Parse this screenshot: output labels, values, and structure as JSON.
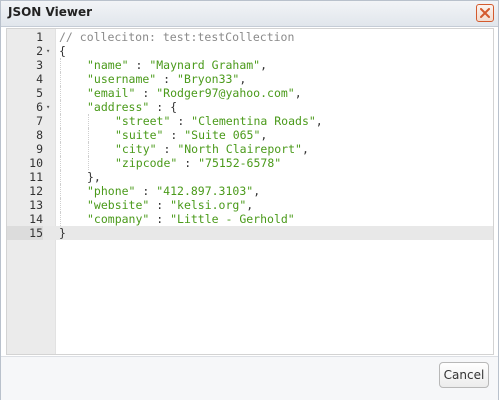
{
  "window": {
    "title": "JSON Viewer",
    "close_icon": "close-icon"
  },
  "colors": {
    "string": "#4a9a1a",
    "comment": "#8a8a8a",
    "close_border": "#d35a2e"
  },
  "editor": {
    "active_line": 15,
    "lines": [
      {
        "n": "1",
        "fold": "",
        "indent": 0,
        "comment": "// colleciton: test:testCollection"
      },
      {
        "n": "2",
        "fold": "▾",
        "indent": 0,
        "punc": "{"
      },
      {
        "n": "3",
        "fold": "",
        "indent": 1,
        "key": "\"name\"",
        "sep": " : ",
        "value": "\"Maynard Graham\"",
        "trail": ","
      },
      {
        "n": "4",
        "fold": "",
        "indent": 1,
        "key": "\"username\"",
        "sep": " : ",
        "value": "\"Bryon33\"",
        "trail": ","
      },
      {
        "n": "5",
        "fold": "",
        "indent": 1,
        "key": "\"email\"",
        "sep": " : ",
        "value": "\"Rodger97@yahoo.com\"",
        "trail": ","
      },
      {
        "n": "6",
        "fold": "▾",
        "indent": 1,
        "key": "\"address\"",
        "sep": " : ",
        "value": "",
        "trail": "{"
      },
      {
        "n": "7",
        "fold": "",
        "indent": 2,
        "key": "\"street\"",
        "sep": " : ",
        "value": "\"Clementina Roads\"",
        "trail": ","
      },
      {
        "n": "8",
        "fold": "",
        "indent": 2,
        "key": "\"suite\"",
        "sep": " : ",
        "value": "\"Suite 065\"",
        "trail": ","
      },
      {
        "n": "9",
        "fold": "",
        "indent": 2,
        "key": "\"city\"",
        "sep": " : ",
        "value": "\"North Claireport\"",
        "trail": ","
      },
      {
        "n": "10",
        "fold": "",
        "indent": 2,
        "key": "\"zipcode\"",
        "sep": " : ",
        "value": "\"75152-6578\"",
        "trail": ""
      },
      {
        "n": "11",
        "fold": "",
        "indent": 1,
        "punc": "},"
      },
      {
        "n": "12",
        "fold": "",
        "indent": 1,
        "key": "\"phone\"",
        "sep": " : ",
        "value": "\"412.897.3103\"",
        "trail": ","
      },
      {
        "n": "13",
        "fold": "",
        "indent": 1,
        "key": "\"website\"",
        "sep": " : ",
        "value": "\"kelsi.org\"",
        "trail": ","
      },
      {
        "n": "14",
        "fold": "",
        "indent": 1,
        "key": "\"company\"",
        "sep": " : ",
        "value": "\"Little - Gerhold\"",
        "trail": ""
      },
      {
        "n": "15",
        "fold": "",
        "indent": 0,
        "punc": "}"
      }
    ]
  },
  "footer": {
    "cancel_label": "Cancel"
  }
}
